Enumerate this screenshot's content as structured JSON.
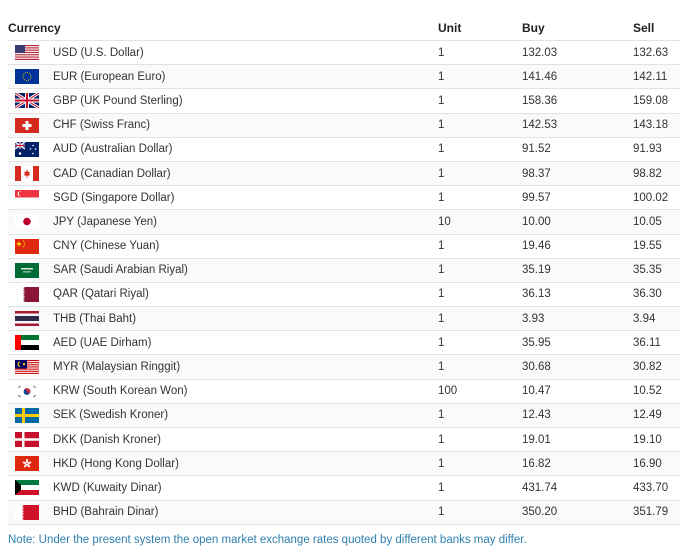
{
  "headers": {
    "currency": "Currency",
    "unit": "Unit",
    "buy": "Buy",
    "sell": "Sell"
  },
  "rows": [
    {
      "currency": "USD (U.S. Dollar)",
      "unit": "1",
      "buy": "132.03",
      "sell": "132.63",
      "flag": "us-flag-icon"
    },
    {
      "currency": "EUR (European Euro)",
      "unit": "1",
      "buy": "141.46",
      "sell": "142.11",
      "flag": "eu-flag-icon"
    },
    {
      "currency": "GBP (UK Pound Sterling)",
      "unit": "1",
      "buy": "158.36",
      "sell": "159.08",
      "flag": "uk-flag-icon"
    },
    {
      "currency": "CHF (Swiss Franc)",
      "unit": "1",
      "buy": "142.53",
      "sell": "143.18",
      "flag": "ch-flag-icon"
    },
    {
      "currency": "AUD (Australian Dollar)",
      "unit": "1",
      "buy": "91.52",
      "sell": "91.93",
      "flag": "au-flag-icon"
    },
    {
      "currency": "CAD (Canadian Dollar)",
      "unit": "1",
      "buy": "98.37",
      "sell": "98.82",
      "flag": "ca-flag-icon"
    },
    {
      "currency": "SGD (Singapore Dollar)",
      "unit": "1",
      "buy": "99.57",
      "sell": "100.02",
      "flag": "sg-flag-icon"
    },
    {
      "currency": "JPY (Japanese Yen)",
      "unit": "10",
      "buy": "10.00",
      "sell": "10.05",
      "flag": "jp-flag-icon"
    },
    {
      "currency": "CNY (Chinese Yuan)",
      "unit": "1",
      "buy": "19.46",
      "sell": "19.55",
      "flag": "cn-flag-icon"
    },
    {
      "currency": "SAR (Saudi Arabian Riyal)",
      "unit": "1",
      "buy": "35.19",
      "sell": "35.35",
      "flag": "sa-flag-icon"
    },
    {
      "currency": "QAR (Qatari Riyal)",
      "unit": "1",
      "buy": "36.13",
      "sell": "36.30",
      "flag": "qa-flag-icon"
    },
    {
      "currency": "THB (Thai Baht)",
      "unit": "1",
      "buy": "3.93",
      "sell": "3.94",
      "flag": "th-flag-icon"
    },
    {
      "currency": "AED (UAE Dirham)",
      "unit": "1",
      "buy": "35.95",
      "sell": "36.11",
      "flag": "ae-flag-icon"
    },
    {
      "currency": "MYR (Malaysian Ringgit)",
      "unit": "1",
      "buy": "30.68",
      "sell": "30.82",
      "flag": "my-flag-icon"
    },
    {
      "currency": "KRW (South Korean Won)",
      "unit": "100",
      "buy": "10.47",
      "sell": "10.52",
      "flag": "kr-flag-icon"
    },
    {
      "currency": "SEK (Swedish Kroner)",
      "unit": "1",
      "buy": "12.43",
      "sell": "12.49",
      "flag": "se-flag-icon"
    },
    {
      "currency": "DKK (Danish Kroner)",
      "unit": "1",
      "buy": "19.01",
      "sell": "19.10",
      "flag": "dk-flag-icon"
    },
    {
      "currency": "HKD (Hong Kong Dollar)",
      "unit": "1",
      "buy": "16.82",
      "sell": "16.90",
      "flag": "hk-flag-icon"
    },
    {
      "currency": "KWD (Kuwaity Dinar)",
      "unit": "1",
      "buy": "431.74",
      "sell": "433.70",
      "flag": "kw-flag-icon"
    },
    {
      "currency": "BHD (Bahrain Dinar)",
      "unit": "1",
      "buy": "350.20",
      "sell": "351.79",
      "flag": "bh-flag-icon"
    }
  ],
  "note": "Note: Under the present system the open market exchange rates quoted by different banks may differ.",
  "colors": {
    "note": "#2e7fae",
    "border": "#e2e2e2"
  }
}
